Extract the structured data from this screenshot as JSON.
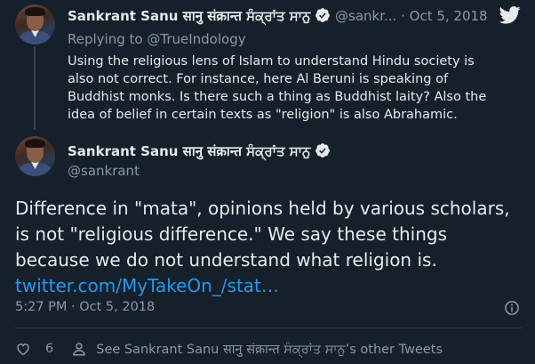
{
  "parent_tweet": {
    "author_name": "Sankrant Sanu सानु संक्रान्त ਸੰਕ੍ਰਾਂਤ ਸਾਨੁ",
    "author_handle": "@sankr...",
    "separator": "·",
    "date": "Oct 5, 2018",
    "replying_label": "Replying to",
    "replying_handle": "@TrueIndology",
    "text": "Using the religious lens of Islam to understand Hindu society is also not correct. For instance, here Al Beruni is speaking of Buddhist monks. Is there such a thing as Buddhist laity? Also the idea of belief in certain texts as \"religion\" is also Abrahamic."
  },
  "main_tweet": {
    "author_name": "Sankrant Sanu सानु संक्रान्त ਸੰਕ੍ਰਾਂਤ ਸਾਨੁ",
    "author_handle": "@sankrant",
    "text": "Difference in \"mata\", opinions held by various scholars, is not \"religious difference.\" We say these things because we do not understand what religion is.",
    "link": "twitter.com/MyTakeOn_/stat…",
    "timestamp": "5:27 PM · Oct 5, 2018"
  },
  "footer": {
    "like_count": "6",
    "other_tweets_label": "See Sankrant Sanu सानु संक्रान्त ਸੰਕ੍ਰਾਂਤ ਸਾਨੁ’s other Tweets"
  },
  "icons": {
    "verified": "verified-badge-icon",
    "twitter": "twitter-bird-icon",
    "info": "info-icon",
    "like": "heart-icon",
    "profile": "person-icon"
  },
  "colors": {
    "background": "#15202b",
    "accent": "#1d9bf0",
    "muted": "#8b98a5",
    "text": "#e7e9ea"
  }
}
